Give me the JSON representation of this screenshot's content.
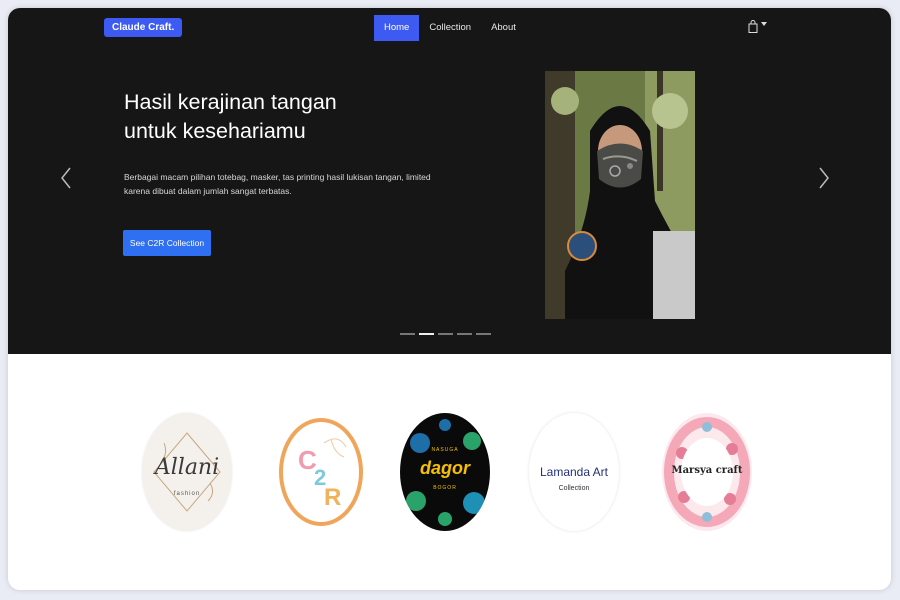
{
  "navbar": {
    "brand": "Claude Craft.",
    "items": [
      {
        "label": "Home",
        "active": true
      },
      {
        "label": "Collection",
        "active": false
      },
      {
        "label": "About",
        "active": false
      }
    ],
    "cart_icon": "shopping-bag-icon"
  },
  "hero": {
    "title_line1": "Hasil kerajinan tangan",
    "title_line2": "untuk kesehariamu",
    "description": "Berbagai macam pilihan totebag, masker, tas printing hasil lukisan tangan, limited karena dibuat dalam jumlah sangat terbatas.",
    "cta_label": "See C2R Collection",
    "slide_count": 5,
    "active_slide": 2
  },
  "partners": [
    {
      "name": "Allani",
      "subtitle": "fashion"
    },
    {
      "name": "C2R"
    },
    {
      "top": "NASUGA",
      "name": "dagor",
      "subtitle": "BOGOR"
    },
    {
      "name": "Lamanda Art",
      "subtitle": "Collection"
    },
    {
      "name": "Marsya craft"
    }
  ],
  "colors": {
    "accent": "#3d5bf2",
    "cta": "#2f6ff2",
    "hero_bg": "#161616"
  }
}
